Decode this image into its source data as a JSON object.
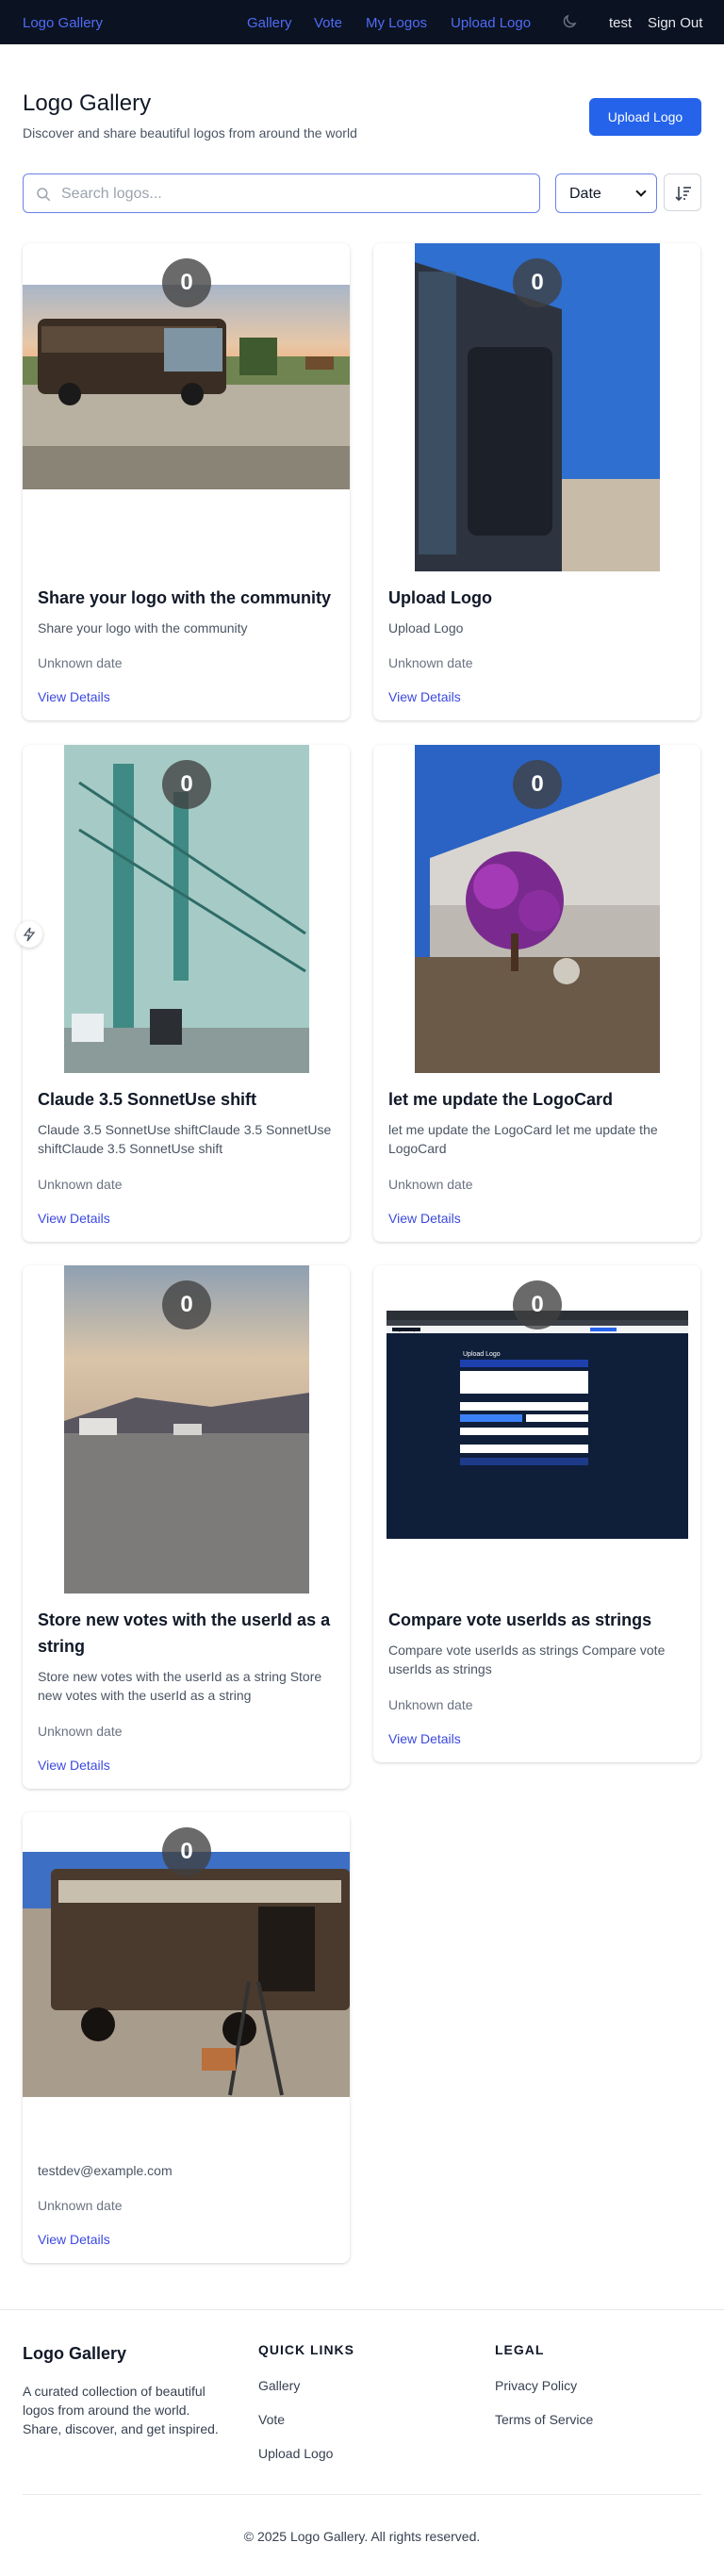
{
  "nav": {
    "brand": "Logo Gallery",
    "links": [
      "Gallery",
      "Vote",
      "My Logos",
      "Upload Logo"
    ],
    "user": "test",
    "signout": "Sign Out"
  },
  "header": {
    "title": "Logo Gallery",
    "subtitle": "Discover and share beautiful logos from around the world",
    "upload_button": "Upload Logo"
  },
  "toolbar": {
    "search_placeholder": "Search logos...",
    "sort_value": "Date"
  },
  "cards": [
    {
      "votes": "0",
      "image": "rv-sunset-photo",
      "title": "Share your logo with the community",
      "description": "Share your logo with the community",
      "date": "Unknown date",
      "link": "View Details"
    },
    {
      "votes": "0",
      "image": "rv-side-blue-sky-photo",
      "title": "Upload Logo",
      "description": "Upload Logo",
      "date": "Unknown date",
      "link": "View Details"
    },
    {
      "votes": "0",
      "image": "ambassador-bridge-photo",
      "title": "Claude 3.5 SonnetUse shift",
      "description": "Claude 3.5 SonnetUse shiftClaude 3.5 SonnetUse shiftClaude 3.5 SonnetUse shift",
      "date": "Unknown date",
      "link": "View Details"
    },
    {
      "votes": "0",
      "image": "bougainvillea-house-photo",
      "title": "let me update the LogoCard",
      "description": "let me update the LogoCard let me update the LogoCard",
      "date": "Unknown date",
      "link": "View Details"
    },
    {
      "votes": "0",
      "image": "desert-rv-park-photo",
      "title": "Store new votes with the userId as a string",
      "description": "Store new votes with the userId as a string Store new votes with the userId as a string",
      "date": "Unknown date",
      "link": "View Details"
    },
    {
      "votes": "0",
      "image": "upload-form-screenshot",
      "title": "Compare vote userIds as strings",
      "description": "Compare vote userIds as strings Compare vote userIds as strings",
      "date": "Unknown date",
      "link": "View Details"
    },
    {
      "votes": "0",
      "image": "rv-ladder-photo",
      "title": "",
      "description": "testdev@example.com",
      "date": "Unknown date",
      "link": "View Details"
    }
  ],
  "footer": {
    "brand": "Logo Gallery",
    "description": "A curated collection of beautiful logos from around the world. Share, discover, and get inspired.",
    "quick_links_heading": "QUICK LINKS",
    "quick_links": [
      "Gallery",
      "Vote",
      "Upload Logo"
    ],
    "legal_heading": "LEGAL",
    "legal_links": [
      "Privacy Policy",
      "Terms of Service"
    ],
    "copyright": "© 2025 Logo Gallery. All rights reserved."
  },
  "screenshot_mini": {
    "title": "Upload Logo",
    "brand": "Logo Gallery"
  }
}
